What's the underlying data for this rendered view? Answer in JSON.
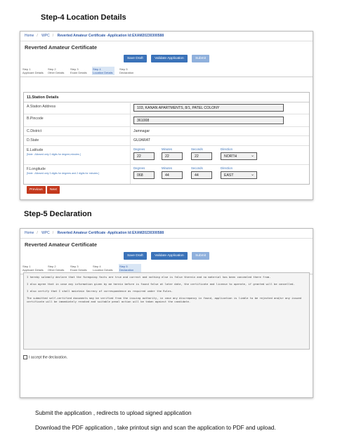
{
  "step4": {
    "heading": "Step-4  Location Details",
    "breadcrumb": [
      "Home",
      "WPC",
      "Reverted Amateur Certificate -Application Id:EXAM20230300588"
    ],
    "title": "Reverted Amateur Certificate",
    "buttons": {
      "save": "Save Draft",
      "validate": "Validate Application",
      "submit": "Submit"
    },
    "steps": [
      {
        "num": "Step 1",
        "name": "Applicant Details"
      },
      {
        "num": "Step 2",
        "name": "Other Details"
      },
      {
        "num": "Step 3",
        "name": "Exam Details"
      },
      {
        "num": "Step 4",
        "name": "Location Details"
      },
      {
        "num": "Step 5",
        "name": "Declaration"
      }
    ],
    "section_title": "11.Station Details",
    "fields": {
      "address_label": "A.Station Address",
      "address_value": "103, KANAN APARTMENTS, 8/1, PATEL COLONY",
      "pincode_label": "B.Pincode",
      "pincode_value": "361008",
      "district_label": "C.District",
      "district_value": "Jamnagar",
      "state_label": "D.State",
      "state_value": "GUJARAT",
      "lat_label": "E.Latitude",
      "lat_note": "[Note : Allowed only 2 digits for degree,minutes ]",
      "lon_label": "F.Longitude",
      "lon_note": "[Note : Allowed only 3 digits for degrees and 2 digits for minutes ]",
      "sub_degrees": "Degrees",
      "sub_minutes": "Minutes",
      "sub_seconds": "Seconds",
      "sub_direction": "Direction",
      "lat_deg": "22",
      "lat_min": "22",
      "lat_sec": "22",
      "lat_dir": "NORTH",
      "lon_deg": "068",
      "lon_min": "44",
      "lon_sec": "44",
      "lon_dir": "EAST"
    },
    "nav": {
      "previous": "Previous",
      "next": "Next"
    }
  },
  "step5": {
    "heading": "Step-5  Declaration",
    "breadcrumb": [
      "Home",
      "WPC",
      "Reverted Amateur Certificate -Application Id:EXAM20230300588"
    ],
    "title": "Reverted Amateur Certificate",
    "buttons": {
      "save": "Save Draft",
      "validate": "Validate Application",
      "submit": "Submit"
    },
    "steps": [
      {
        "num": "Step 1",
        "name": "Applicant Details"
      },
      {
        "num": "Step 2",
        "name": "Other Details"
      },
      {
        "num": "Step 3",
        "name": "Exam Details"
      },
      {
        "num": "Step 4",
        "name": "Location Details"
      },
      {
        "num": "Step 5",
        "name": "Declaration"
      }
    ],
    "declaration": [
      "I hereby solemnly declare that the foregoing facts are true and correct and nothing else is false therein and no material has been concealed there from.",
      "I also agree that in case any information given by me herein before is found false at later date, the certificate and license to operate, if granted will be cancelled.",
      "I also certify that I shall maintain Secrecy of correspondence as required under the Rules.",
      "The submitted self-certified documents may be verified from the issuing authority, in case any discrepancy in found, application is liable to be rejected and/or any issued certificate will be immediately revoked and suitable penal action will be taken against the candidate."
    ],
    "accept_label": "I accept the declaration."
  },
  "footer": {
    "line1": "Submit the application , redirects to upload signed application",
    "line2": "Download the PDF application , take printout    sign and scan the application to PDF and upload."
  }
}
